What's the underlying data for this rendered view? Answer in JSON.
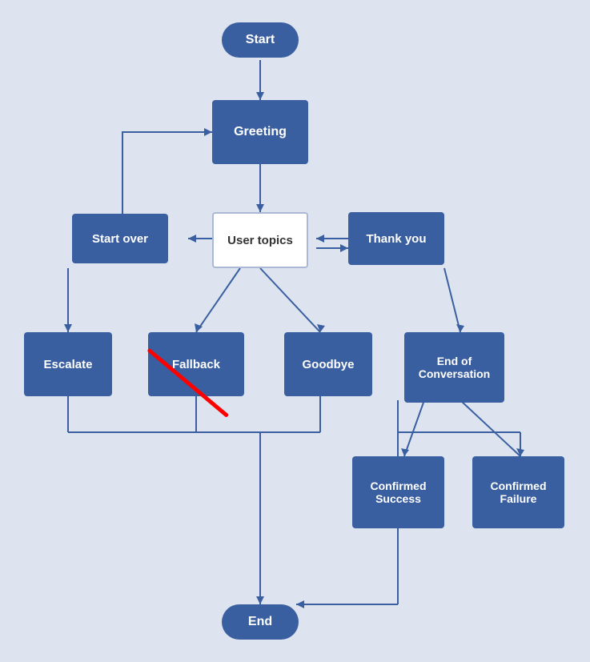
{
  "nodes": {
    "start": {
      "label": "Start"
    },
    "greeting": {
      "label": "Greeting"
    },
    "user_topics": {
      "label": "User topics"
    },
    "start_over": {
      "label": "Start over"
    },
    "thank_you": {
      "label": "Thank you"
    },
    "escalate": {
      "label": "Escalate"
    },
    "fallback": {
      "label": "Fallback"
    },
    "goodbye": {
      "label": "Goodbye"
    },
    "end_of_conversation": {
      "label": "End of\nConversation"
    },
    "confirmed_success": {
      "label": "Confirmed\nSuccess"
    },
    "confirmed_failure": {
      "label": "Confirmed\nFailure"
    },
    "end": {
      "label": "End"
    }
  }
}
